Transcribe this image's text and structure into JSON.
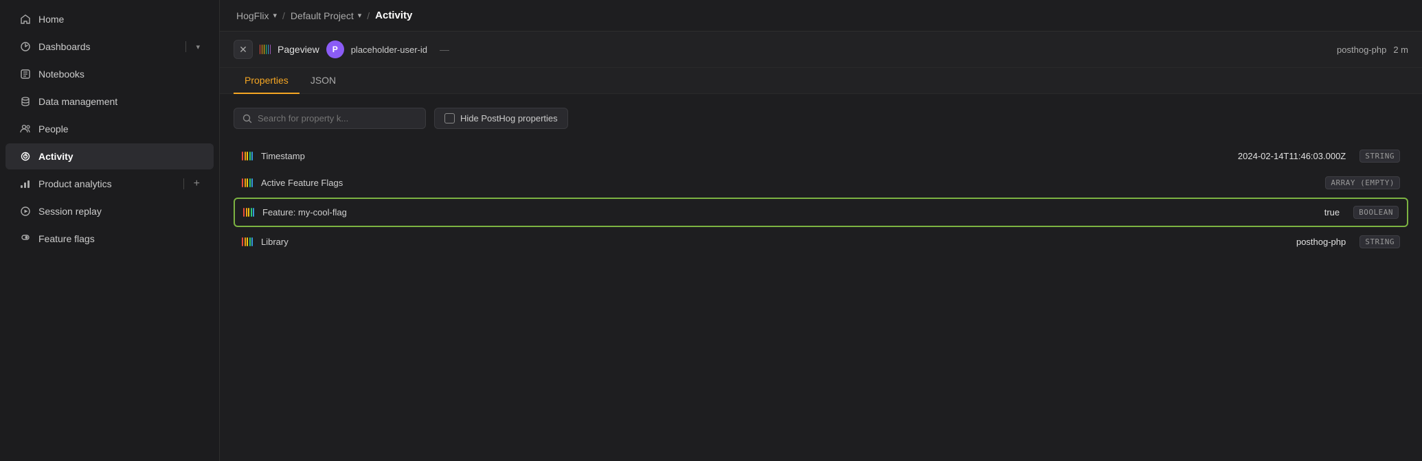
{
  "sidebar": {
    "items": [
      {
        "id": "home",
        "label": "Home",
        "icon": "home",
        "active": false
      },
      {
        "id": "dashboards",
        "label": "Dashboards",
        "icon": "dashboards",
        "active": false,
        "hasChevron": true,
        "hasDivider": true
      },
      {
        "id": "notebooks",
        "label": "Notebooks",
        "icon": "notebooks",
        "active": false
      },
      {
        "id": "data-management",
        "label": "Data management",
        "icon": "data-management",
        "active": false
      },
      {
        "id": "people",
        "label": "People",
        "icon": "people",
        "active": false
      },
      {
        "id": "activity",
        "label": "Activity",
        "icon": "activity",
        "active": true
      },
      {
        "id": "product-analytics",
        "label": "Product analytics",
        "icon": "product-analytics",
        "active": false,
        "hasPlus": true
      },
      {
        "id": "session-replay",
        "label": "Session replay",
        "icon": "session-replay",
        "active": false
      },
      {
        "id": "feature-flags",
        "label": "Feature flags",
        "icon": "feature-flags",
        "active": false
      }
    ]
  },
  "breadcrumb": {
    "org": "HogFlix",
    "project": "Default Project",
    "page": "Activity"
  },
  "event": {
    "name": "Pageview",
    "user_id": "placeholder-user-id",
    "library": "posthog-php",
    "more": "2 m"
  },
  "tabs": [
    {
      "id": "properties",
      "label": "Properties",
      "active": true
    },
    {
      "id": "json",
      "label": "JSON",
      "active": false
    }
  ],
  "search": {
    "placeholder": "Search for property k..."
  },
  "filter": {
    "label": "Hide PostHog properties"
  },
  "properties": [
    {
      "name": "Timestamp",
      "value": "2024-02-14T11:46:03.000Z",
      "type": "STRING",
      "highlighted": false
    },
    {
      "name": "Active Feature Flags",
      "value": "",
      "type": "ARRAY (EMPTY)",
      "highlighted": false
    },
    {
      "name": "Feature: my-cool-flag",
      "value": "true",
      "type": "BOOLEAN",
      "highlighted": true
    },
    {
      "name": "Library",
      "value": "posthog-php",
      "type": "STRING",
      "highlighted": false
    }
  ],
  "colors": {
    "accent_yellow": "#f5a623",
    "highlight_green": "#7cb342",
    "avatar_purple": "#8b5cf6"
  }
}
